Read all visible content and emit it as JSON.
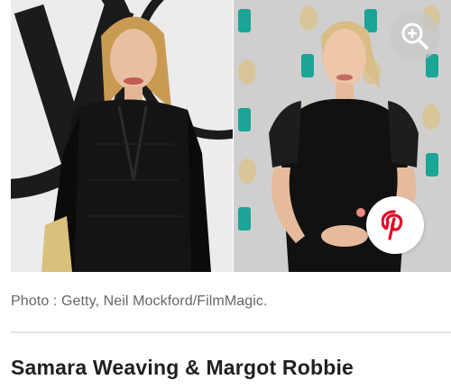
{
  "caption": {
    "text": "Photo : Getty, Neil Mockford/FilmMagic."
  },
  "article": {
    "title": "Samara Weaving & Margot Robbie"
  },
  "icons": {
    "zoom": "zoom-in-icon",
    "pinterest": "pinterest-icon"
  },
  "colors": {
    "pinterest_red": "#e60023",
    "caption_gray": "#666666",
    "title_dark": "#1f1f1f",
    "backdrop_teal": "#1aa595"
  }
}
